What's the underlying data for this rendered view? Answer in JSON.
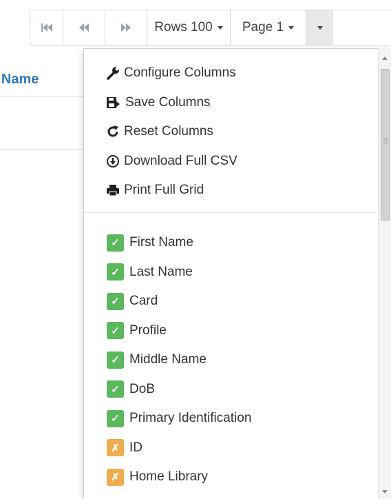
{
  "toolbar": {
    "rows_label": "Rows 100",
    "page_label": "Page 1"
  },
  "grid": {
    "header": "Middle Name"
  },
  "menu": {
    "actions": [
      {
        "label": "Configure Columns",
        "icon": "wrench-icon"
      },
      {
        "label": "Save Columns",
        "icon": "floppy-save-icon"
      },
      {
        "label": "Reset Columns",
        "icon": "refresh-icon"
      },
      {
        "label": "Download Full CSV",
        "icon": "download-circle-icon"
      },
      {
        "label": "Print Full Grid",
        "icon": "printer-icon"
      }
    ],
    "columns": [
      {
        "label": "First Name",
        "checked": true,
        "mark": "✓"
      },
      {
        "label": "Last Name",
        "checked": true,
        "mark": "✓"
      },
      {
        "label": "Card",
        "checked": true,
        "mark": "✓"
      },
      {
        "label": "Profile",
        "checked": true,
        "mark": "✓"
      },
      {
        "label": "Middle Name",
        "checked": true,
        "mark": "✓"
      },
      {
        "label": "DoB",
        "checked": true,
        "mark": "✓"
      },
      {
        "label": "Primary Identification",
        "checked": true,
        "mark": "✓"
      },
      {
        "label": "ID",
        "checked": false,
        "mark": "✗"
      },
      {
        "label": "Home Library",
        "checked": false,
        "mark": "✗"
      }
    ]
  },
  "colors": {
    "checked": "#5cb85c",
    "unchecked": "#f0ad4e",
    "link_header": "#2f77b5"
  }
}
